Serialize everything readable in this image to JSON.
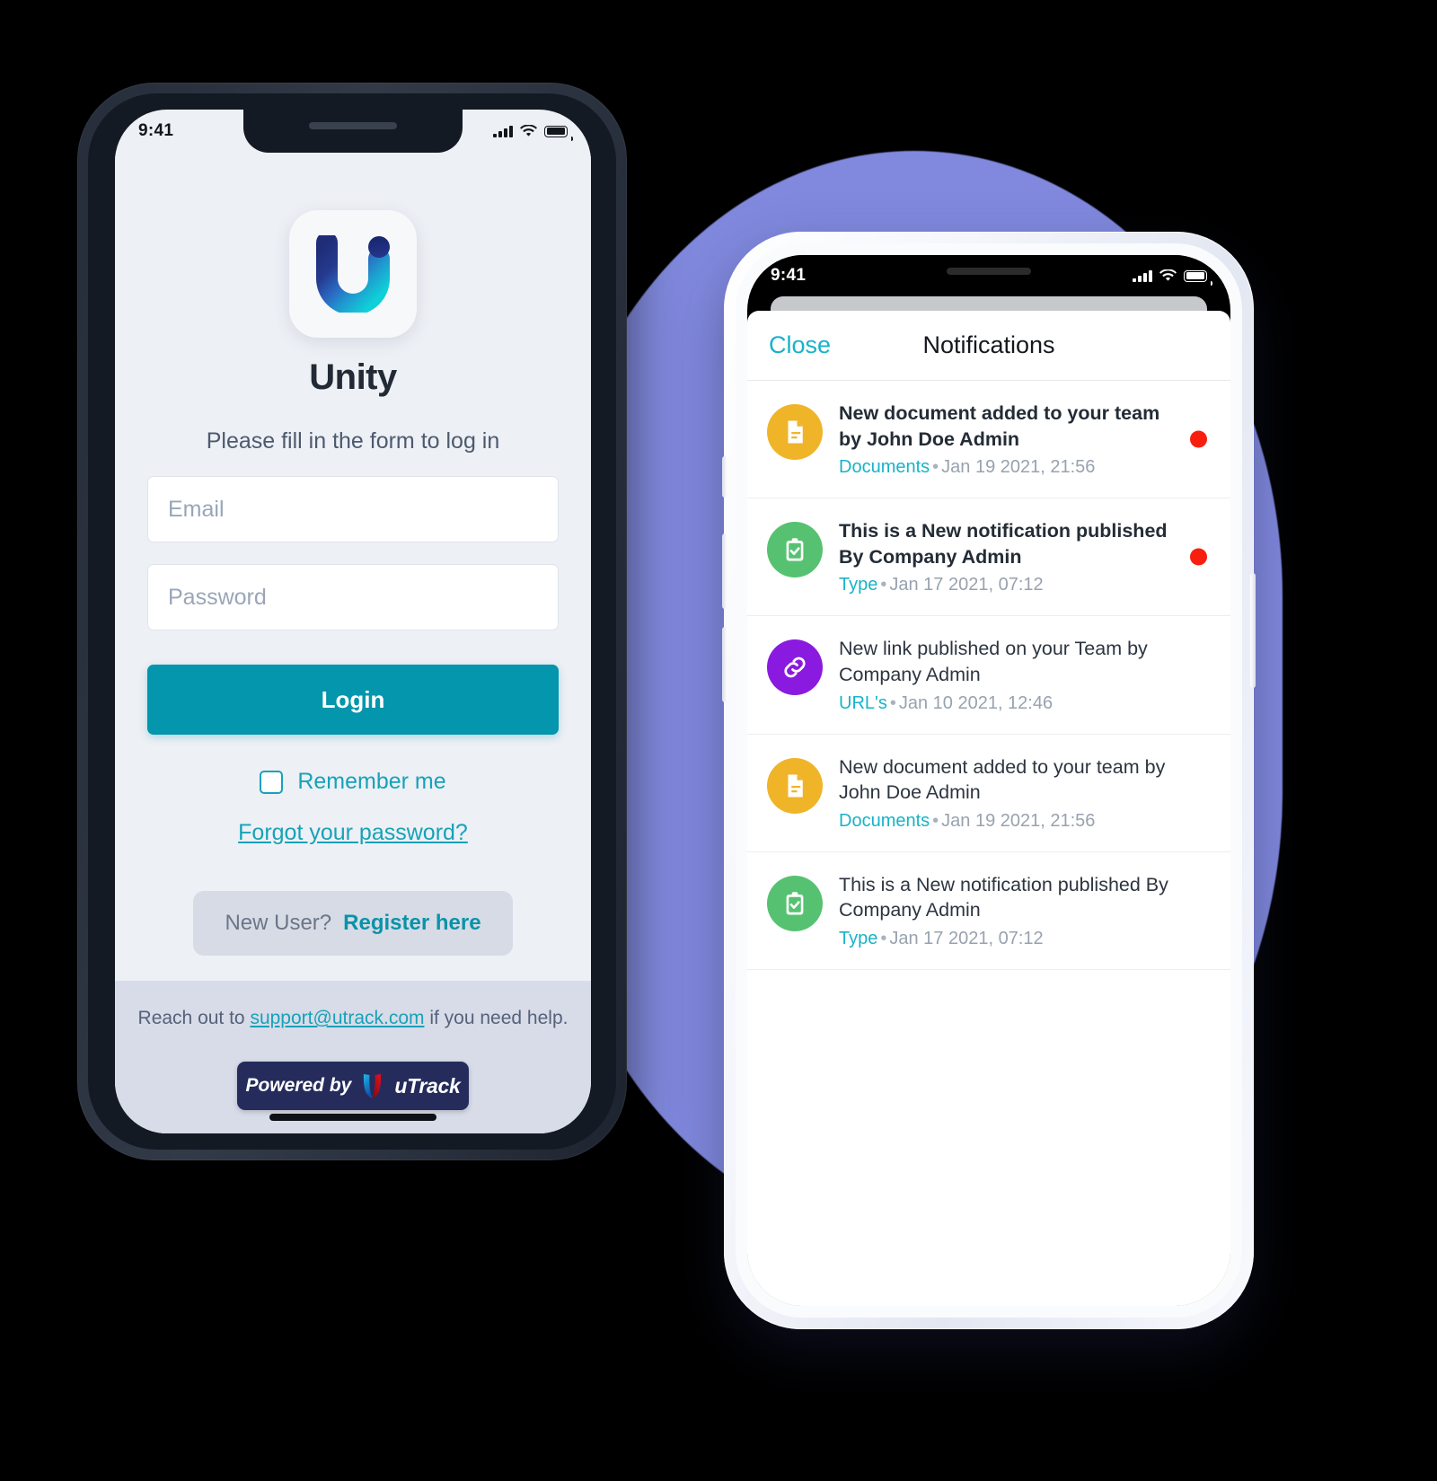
{
  "colors": {
    "accent_teal": "#17a2b8",
    "login_button": "#0396ac",
    "blob_purple": "#8189de",
    "badge_navy": "#252c5c",
    "unread_dot": "#f81f0e",
    "doc_yellow": "#f0b429",
    "type_green": "#56c271",
    "link_purple": "#8a1ae0",
    "screen_bg": "#edf0f5",
    "footer_bg": "#d8dce8"
  },
  "login_phone": {
    "status_bar": {
      "time": "9:41",
      "signal_icon": "cellular-signal-icon",
      "wifi_icon": "wifi-icon",
      "battery_icon": "battery-full-icon"
    },
    "app_logo_icon": "unity-u-logo-icon",
    "brand_title": "Unity",
    "subtitle": "Please fill in the form to log in",
    "fields": [
      {
        "name": "email",
        "value": "",
        "placeholder": "Email"
      },
      {
        "name": "password",
        "value": "",
        "placeholder": "Password"
      }
    ],
    "login_button_label": "Login",
    "remember_me": {
      "label": "Remember me",
      "checked": false,
      "icon": "checkbox-unchecked-icon"
    },
    "forgot_password_label": "Forgot your password?",
    "register": {
      "question": "New User?",
      "action": "Register here"
    },
    "footer": {
      "help_prefix": "Reach out to ",
      "help_email": "support@utrack.com",
      "help_suffix": " if you need help.",
      "badge_prefix": "Powered by",
      "badge_mark_icon": "utrack-u-mark-icon",
      "badge_brand": "uTrack"
    },
    "home_indicator_icon": "home-indicator-bar"
  },
  "notifications_phone": {
    "status_bar": {
      "time": "9:41",
      "signal_icon": "cellular-signal-icon",
      "wifi_icon": "wifi-icon",
      "battery_icon": "battery-full-icon"
    },
    "sheet": {
      "close_label": "Close",
      "title": "Notifications"
    },
    "items": [
      {
        "icon": "document-icon",
        "icon_color": "#f0b429",
        "title": "New document added to your team by John Doe Admin",
        "category": "Documents",
        "separator": "•",
        "date": "Jan 19 2021, 21:56",
        "unread": true
      },
      {
        "icon": "clipboard-check-icon",
        "icon_color": "#56c271",
        "title": "This is a New notification published By Company Admin",
        "category": "Type",
        "separator": "•",
        "date": "Jan 17 2021, 07:12",
        "unread": true
      },
      {
        "icon": "link-chain-icon",
        "icon_color": "#8a1ae0",
        "title": "New link published on your Team by Company Admin",
        "category": "URL's",
        "separator": "•",
        "date": "Jan 10 2021, 12:46",
        "unread": false
      },
      {
        "icon": "document-icon",
        "icon_color": "#f0b429",
        "title": "New document added to your team by John Doe Admin",
        "category": "Documents",
        "separator": "•",
        "date": "Jan 19 2021, 21:56",
        "unread": false
      },
      {
        "icon": "clipboard-check-icon",
        "icon_color": "#56c271",
        "title": "This is a New notification published By Company Admin",
        "category": "Type",
        "separator": "•",
        "date": "Jan 17 2021, 07:12",
        "unread": false
      }
    ]
  }
}
